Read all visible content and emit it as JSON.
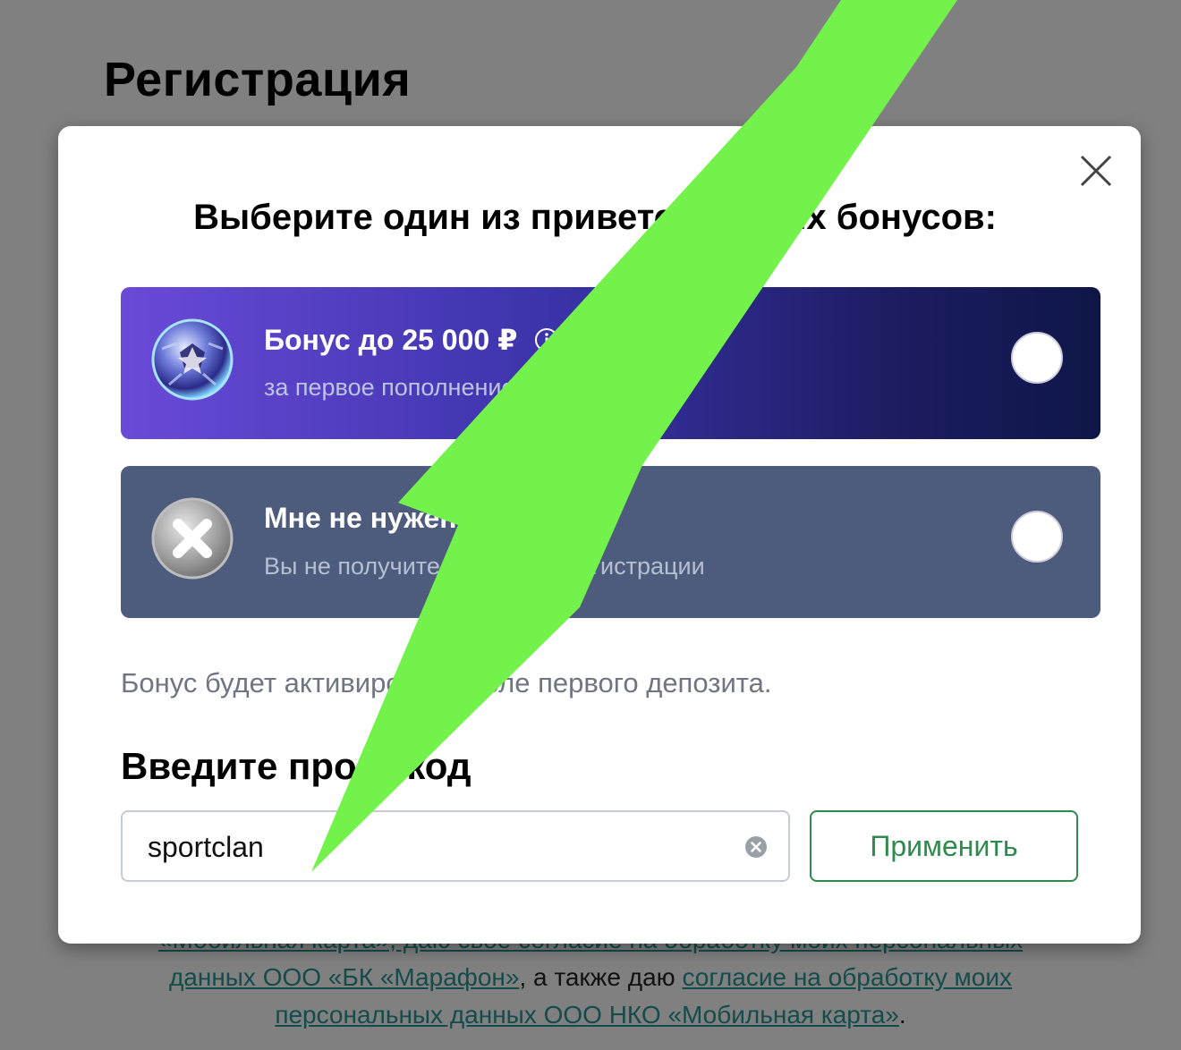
{
  "page": {
    "title": "Регистрация"
  },
  "consent": {
    "line1": "«Мобильная карта», даю свое согласие на обработку моих персональных",
    "line2_link": "данных ООО «БК «Марафон»",
    "line2_text": ", а также даю ",
    "line2_link2": "согласие на обработку моих",
    "line3_link": "персональных данных ООО НКО «Мобильная карта»",
    "line3_text": "."
  },
  "modal": {
    "heading": "Выберите один из приветственных бонусов:",
    "options": [
      {
        "title": "Бонус до 25 000 ₽",
        "subtitle": "за первое пополнение",
        "icon": "soccer-ball-icon",
        "has_info": true
      },
      {
        "title": "Мне не нужен бонус",
        "subtitle": "Вы не получите бонус при регистрации",
        "icon": "cross-icon",
        "has_info": false
      }
    ],
    "note": "Бонус будет активирован после первого депозита.",
    "promo": {
      "label": "Введите промокод",
      "value": "sportclan",
      "apply_label": "Применить"
    }
  },
  "colors": {
    "overlay": "#808080",
    "accent_green": "#2f8a4f",
    "annotation_arrow": "#72f24a"
  }
}
